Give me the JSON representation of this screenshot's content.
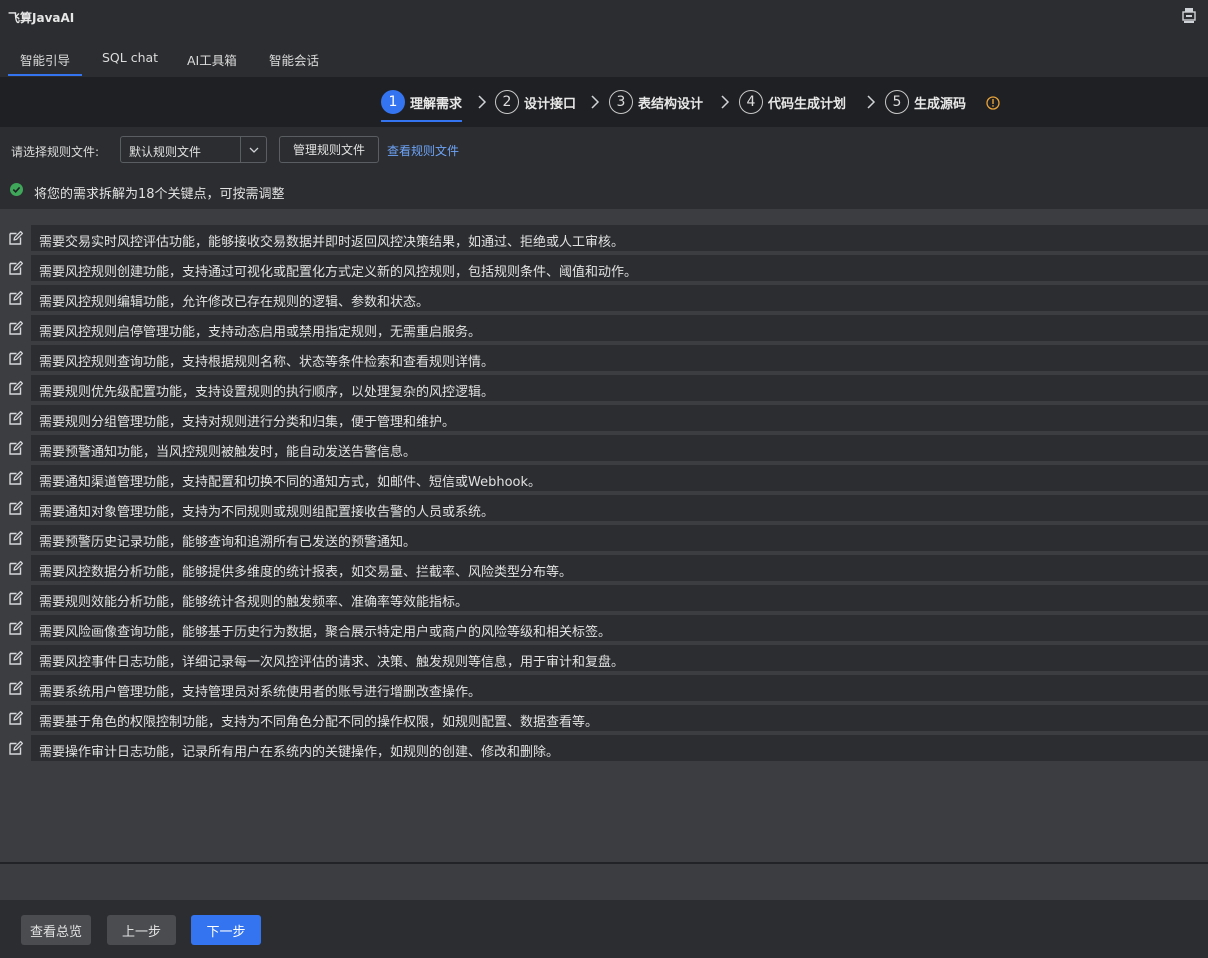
{
  "app": {
    "title": "飞算JavaAI"
  },
  "tabs": [
    {
      "label": "智能引导",
      "active": true
    },
    {
      "label": "SQL chat"
    },
    {
      "label": "AI工具箱"
    },
    {
      "label": "智能会话"
    }
  ],
  "steps": [
    {
      "num": "1",
      "label": "理解需求",
      "active": true
    },
    {
      "num": "2",
      "label": "设计接口"
    },
    {
      "num": "3",
      "label": "表结构设计"
    },
    {
      "num": "4",
      "label": "代码生成计划"
    },
    {
      "num": "5",
      "label": "生成源码"
    }
  ],
  "rules": {
    "label": "请选择规则文件:",
    "selected": "默认规则文件",
    "manage_label": "管理规则文件",
    "view_label": "查看规则文件"
  },
  "status": {
    "text": "将您的需求拆解为18个关键点，可按需调整",
    "color": "#3fa75a"
  },
  "requirements": [
    "需要交易实时风控评估功能，能够接收交易数据并即时返回风控决策结果，如通过、拒绝或人工审核。",
    "需要风控规则创建功能，支持通过可视化或配置化方式定义新的风控规则，包括规则条件、阈值和动作。",
    "需要风控规则编辑功能，允许修改已存在规则的逻辑、参数和状态。",
    "需要风控规则启停管理功能，支持动态启用或禁用指定规则，无需重启服务。",
    "需要风控规则查询功能，支持根据规则名称、状态等条件检索和查看规则详情。",
    "需要规则优先级配置功能，支持设置规则的执行顺序，以处理复杂的风控逻辑。",
    "需要规则分组管理功能，支持对规则进行分类和归集，便于管理和维护。",
    "需要预警通知功能，当风控规则被触发时，能自动发送告警信息。",
    "需要通知渠道管理功能，支持配置和切换不同的通知方式，如邮件、短信或Webhook。",
    "需要通知对象管理功能，支持为不同规则或规则组配置接收告警的人员或系统。",
    "需要预警历史记录功能，能够查询和追溯所有已发送的预警通知。",
    "需要风控数据分析功能，能够提供多维度的统计报表，如交易量、拦截率、风险类型分布等。",
    "需要规则效能分析功能，能够统计各规则的触发频率、准确率等效能指标。",
    "需要风险画像查询功能，能够基于历史行为数据，聚合展示特定用户或商户的风险等级和相关标签。",
    "需要风控事件日志功能，详细记录每一次风控评估的请求、决策、触发规则等信息，用于审计和复盘。",
    "需要系统用户管理功能，支持管理员对系统使用者的账号进行增删改查操作。",
    "需要基于角色的权限控制功能，支持为不同角色分配不同的操作权限，如规则配置、数据查看等。",
    "需要操作审计日志功能，记录所有用户在系统内的关键操作，如规则的创建、修改和删除。"
  ],
  "footer": {
    "overview_label": "查看总览",
    "prev_label": "上一步",
    "next_label": "下一步"
  },
  "colors": {
    "accent": "#3574f0",
    "link": "#6ea3f7",
    "warning": "#e8a33a"
  }
}
